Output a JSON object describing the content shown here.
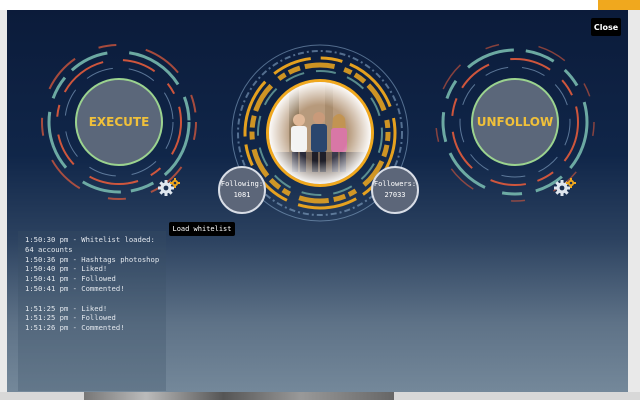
{
  "modal": {
    "close_label": "Close"
  },
  "buttons": {
    "execute_label": "EXECUTE",
    "unfollow_label": "UNFOLLOW",
    "whitelist_label": "Load whitelist"
  },
  "stats": {
    "following_label": "Following:",
    "following_value": "1081",
    "followers_label": "Followers:",
    "followers_value": "27033"
  },
  "icons": {
    "settings": "gear-icon"
  },
  "colors": {
    "accent_orange": "#f0a81e",
    "button_text_yellow": "#f0c03a",
    "button_border_green": "#9bd38f",
    "ring_teal": "#77b8ad",
    "ring_red": "#d9593c",
    "ring_light_blue": "#8eaecf",
    "background_navy": "#0b1b3a"
  },
  "log": {
    "group1": [
      "1:50:30 pm - Whitelist loaded: 64 accounts",
      "1:50:36 pm - Hashtags photoshop",
      "1:50:40 pm - Liked!",
      "1:50:41 pm - Followed",
      "1:50:41 pm - Commented!"
    ],
    "group2": [
      "1:51:25 pm - Liked!",
      "1:51:25 pm - Followed",
      "1:51:26 pm - Commented!"
    ]
  }
}
